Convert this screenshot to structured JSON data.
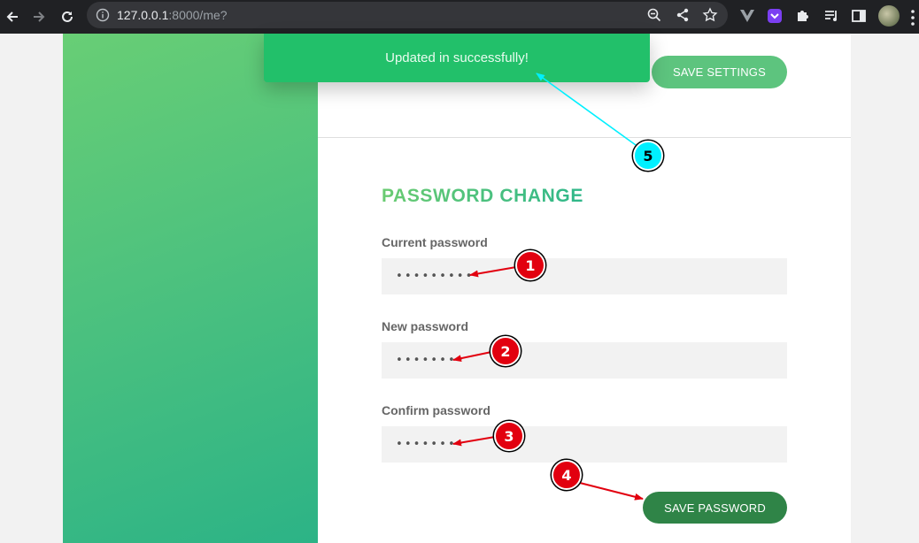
{
  "browser": {
    "url_host": "127.0.0.1",
    "url_rest": ":8000/me?"
  },
  "page": {
    "save_settings_label": "SAVE SETTINGS",
    "section_title": "PASSWORD CHANGE",
    "fields": [
      {
        "label": "Current password",
        "value": "•••••••••"
      },
      {
        "label": "New password",
        "value": "••••••••"
      },
      {
        "label": "Confirm password",
        "value": "••••••••"
      }
    ],
    "save_password_label": "SAVE PASSWORD"
  },
  "toast": {
    "message": "Updated in successfully!"
  },
  "annotations": {
    "markers": [
      "1",
      "2",
      "3",
      "4",
      "5"
    ]
  },
  "colors": {
    "toast": "#22c06a",
    "save_settings_button": "#5dc47e",
    "save_password_button": "#2f8447",
    "marker_red": "#e2000f",
    "marker_cyan": "#00f0ff"
  }
}
